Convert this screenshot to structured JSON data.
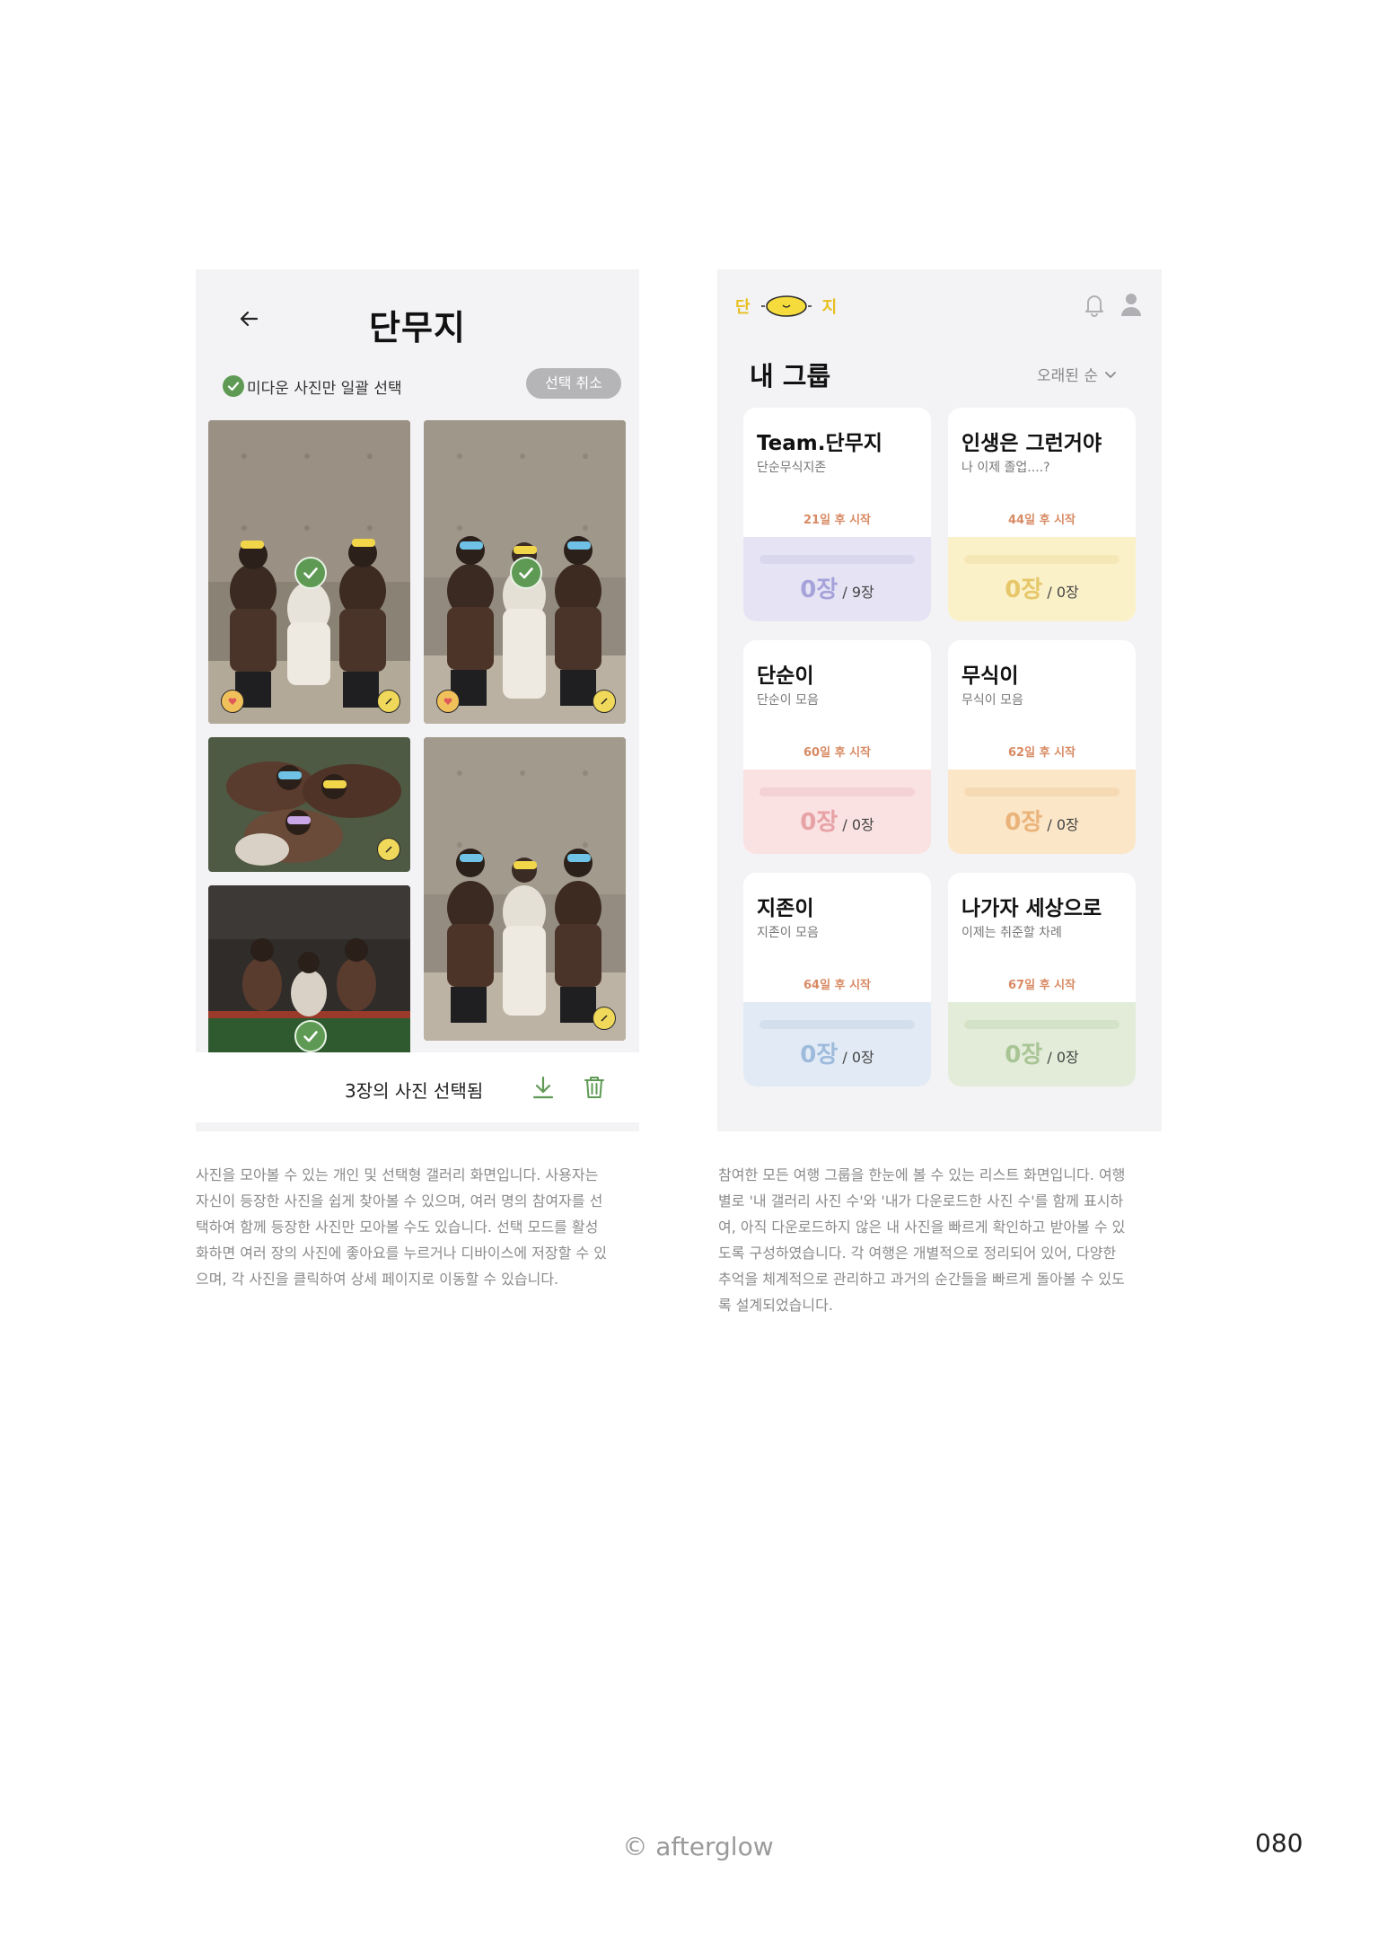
{
  "gallery": {
    "title": "단무지",
    "select_label": "미다운 사진만 일괄 선택",
    "cancel_label": "선택 취소",
    "selected_count_text": "3장의 사진 선택됨",
    "colors": {
      "accent": "#5f9a55",
      "like": "#f0d85a",
      "cancel_bg": "#b5b5b8"
    }
  },
  "groups_screen": {
    "logo": {
      "left": "단",
      "right": "지"
    },
    "heading": "내 그룹",
    "sort_label": "오래된 순",
    "cards": [
      {
        "title": "Team.단무지",
        "subtitle": "단순무식지존",
        "start": "21일 후 시작",
        "count": "0장",
        "total": "/ 9장",
        "bg": "#e6e4f4",
        "bar": "#d9d7ee",
        "count_color": "#a6a2da"
      },
      {
        "title": "인생은 그런거야",
        "subtitle": "나 이제 졸업....?",
        "start": "44일 후 시작",
        "count": "0장",
        "total": "/ 0장",
        "bg": "#fbf1c9",
        "bar": "#f5e8b6",
        "count_color": "#e6c769"
      },
      {
        "title": "단순이",
        "subtitle": "단순이 모음",
        "start": "60일 후 시작",
        "count": "0장",
        "total": "/ 0장",
        "bg": "#fae1e2",
        "bar": "#f4d2d4",
        "count_color": "#e7a2a6"
      },
      {
        "title": "무식이",
        "subtitle": "무식이 모음",
        "start": "62일 후 시작",
        "count": "0장",
        "total": "/ 0장",
        "bg": "#fbe6c8",
        "bar": "#f5dab4",
        "count_color": "#eab37a"
      },
      {
        "title": "지존이",
        "subtitle": "지존이 모음",
        "start": "64일 후 시작",
        "count": "0장",
        "total": "/ 0장",
        "bg": "#e2ebf5",
        "bar": "#d3dfec",
        "count_color": "#9fbbdc"
      },
      {
        "title": "나가자 세상으로",
        "subtitle": "이제는 취준할 차례",
        "start": "67일 후 시작",
        "count": "0장",
        "total": "/ 0장",
        "bg": "#e2ecd9",
        "bar": "#d4e2c8",
        "count_color": "#a9c595"
      }
    ]
  },
  "captions": {
    "left": [
      "사진을 모아볼 수 있는 개인 및 선택형 갤러리 화면입니다. 사용자는",
      "자신이 등장한 사진을 쉽게 찾아볼 수 있으며, 여러 명의 참여자를 선",
      "택하여 함께 등장한 사진만 모아볼 수도 있습니다.  선택 모드를 활성",
      "화하면 여러 장의 사진에 좋아요를 누르거나 디바이스에 저장할 수 있",
      "으며, 각 사진을 클릭하여 상세 페이지로 이동할 수 있습니다."
    ],
    "right": [
      "참여한 모든 여행 그룹을 한눈에 볼 수 있는 리스트 화면입니다. 여행",
      "별로 '내 갤러리 사진 수'와 '내가 다운로드한 사진 수'를 함께 표시하",
      "여, 아직 다운로드하지 않은 내 사진을 빠르게 확인하고 받아볼 수 있",
      "도록 구성하였습니다. 각 여행은 개별적으로 정리되어 있어, 다양한",
      "추억을 체계적으로 관리하고 과거의 순간들을 빠르게 돌아볼 수 있도",
      "록 설계되었습니다."
    ]
  },
  "footer": {
    "brand": "© afterglow",
    "page_number": "080"
  },
  "icons": [
    "back-arrow-icon",
    "check-icon",
    "heart-like-icon",
    "download-icon",
    "trash-icon",
    "lemon-logo-icon",
    "bell-icon",
    "user-icon",
    "chevron-down-icon"
  ]
}
